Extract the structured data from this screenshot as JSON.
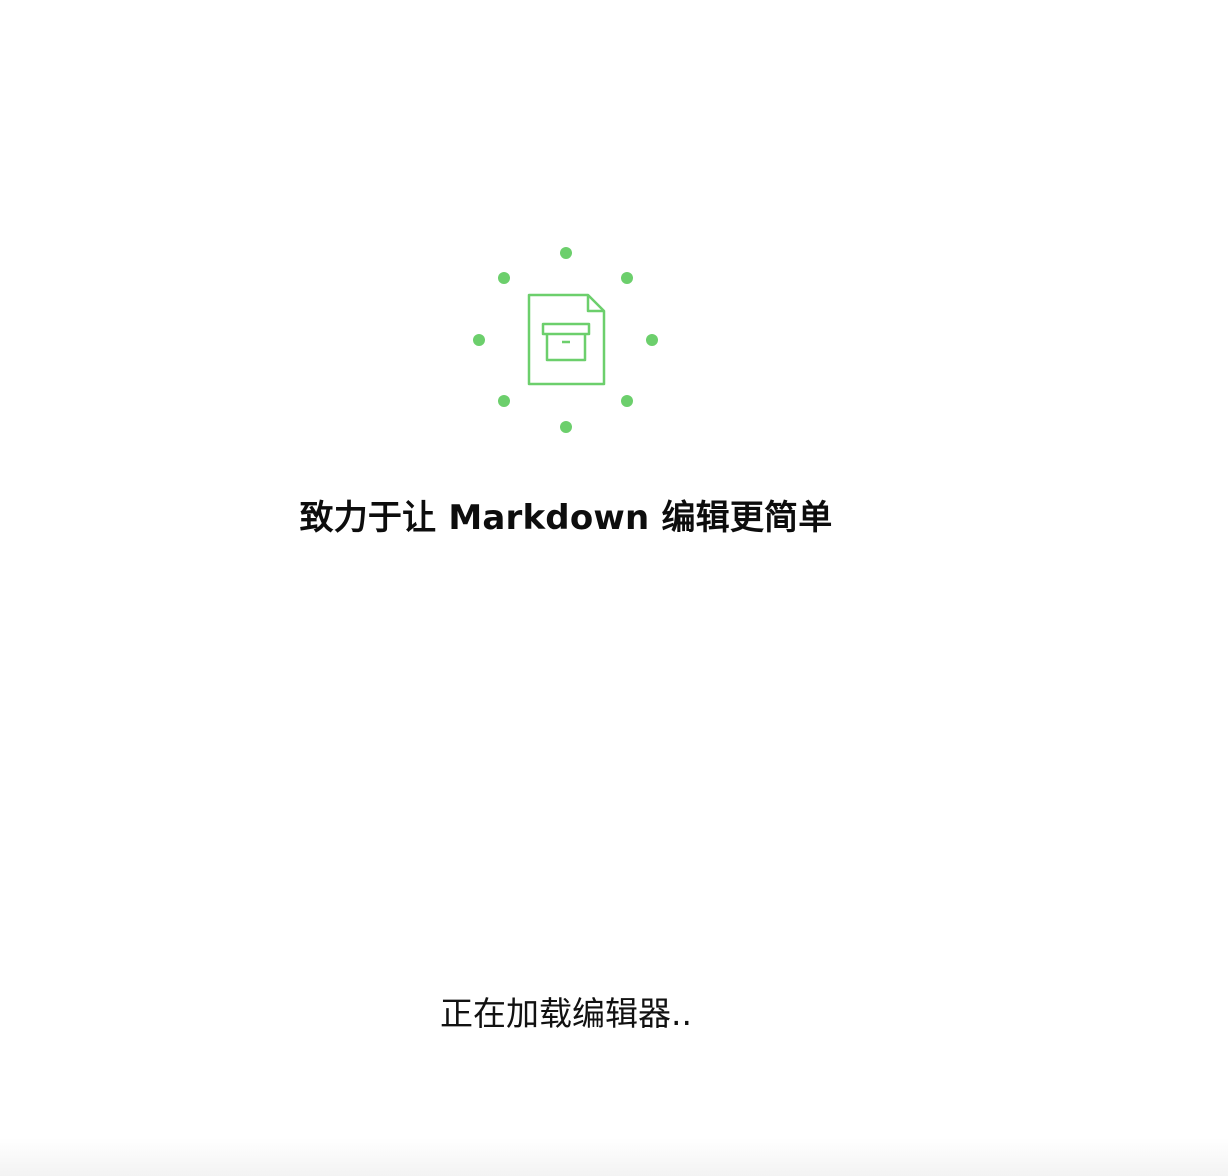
{
  "loader": {
    "icon": "archive-document-icon",
    "dot_count": 8,
    "accent_color": "#6ccf6c"
  },
  "tagline": "致力于让 Markdown 编辑更简单",
  "status": {
    "loading_text": "正在加载编辑器.."
  }
}
